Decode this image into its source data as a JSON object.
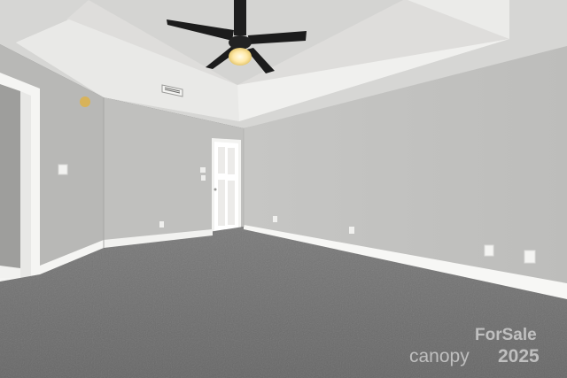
{
  "watermark": {
    "line1": "ForSale",
    "line2": "canopy",
    "year": "2025"
  },
  "colors": {
    "wall_left": "#b3b3b1",
    "wall_back": "#c2c2c0",
    "wall_right": "#c8c8c6",
    "ceiling": "#d9d9d7",
    "tray": "#ebebe9",
    "carpet": "#727272",
    "trim": "#f7f7f5",
    "fan": "#1e1e1e",
    "light": "#fff7dc"
  }
}
